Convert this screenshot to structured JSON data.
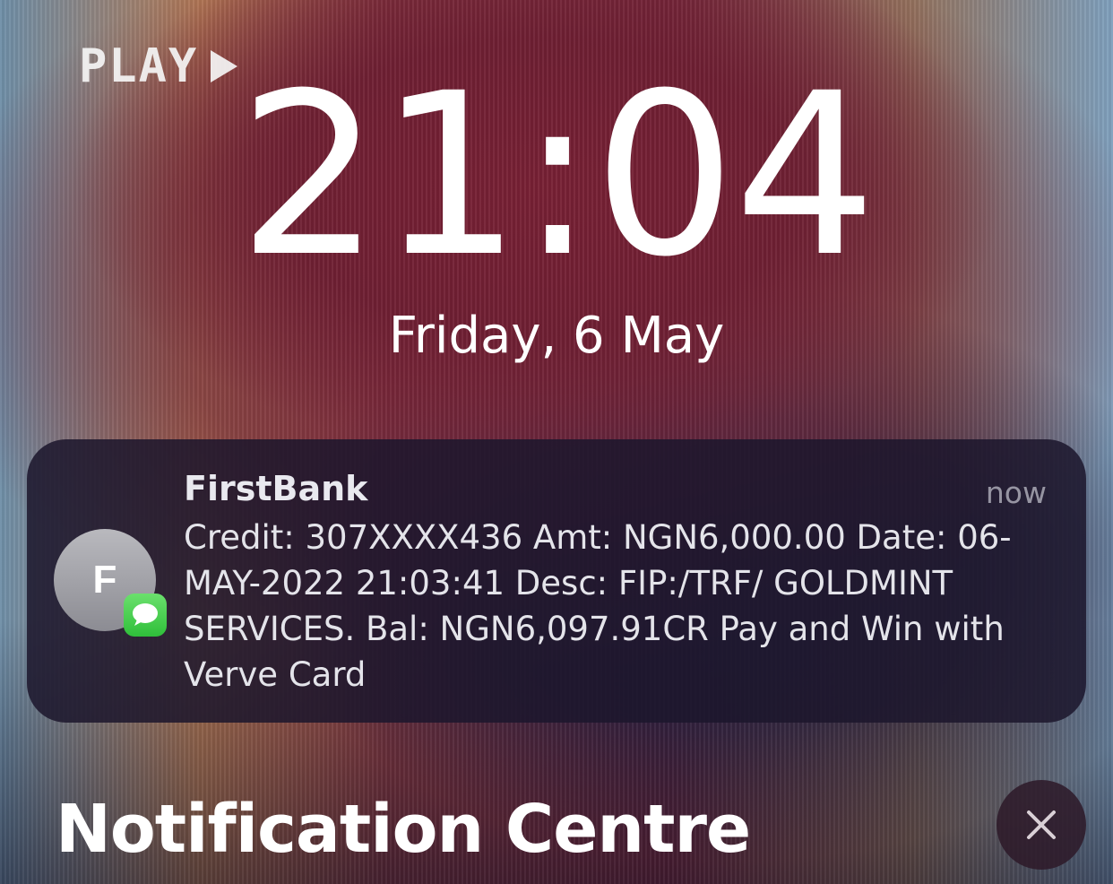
{
  "lockscreen": {
    "play_label": "PLAY",
    "time": "21:04",
    "date": "Friday, 6 May"
  },
  "notification": {
    "app_initial": "F",
    "title": "FirstBank",
    "time": "now",
    "body": "Credit: 307XXXX436 Amt: NGN6,000.00 Date: 06-MAY-2022 21:03:41 Desc: FIP:/TRF/ GOLDMINT SERVICES. Bal: NGN6,097.91CR Pay and Win with Verve Card",
    "badge_icon": "messages-icon"
  },
  "notification_centre": {
    "title": "Notification Centre",
    "close_icon": "close-icon"
  }
}
